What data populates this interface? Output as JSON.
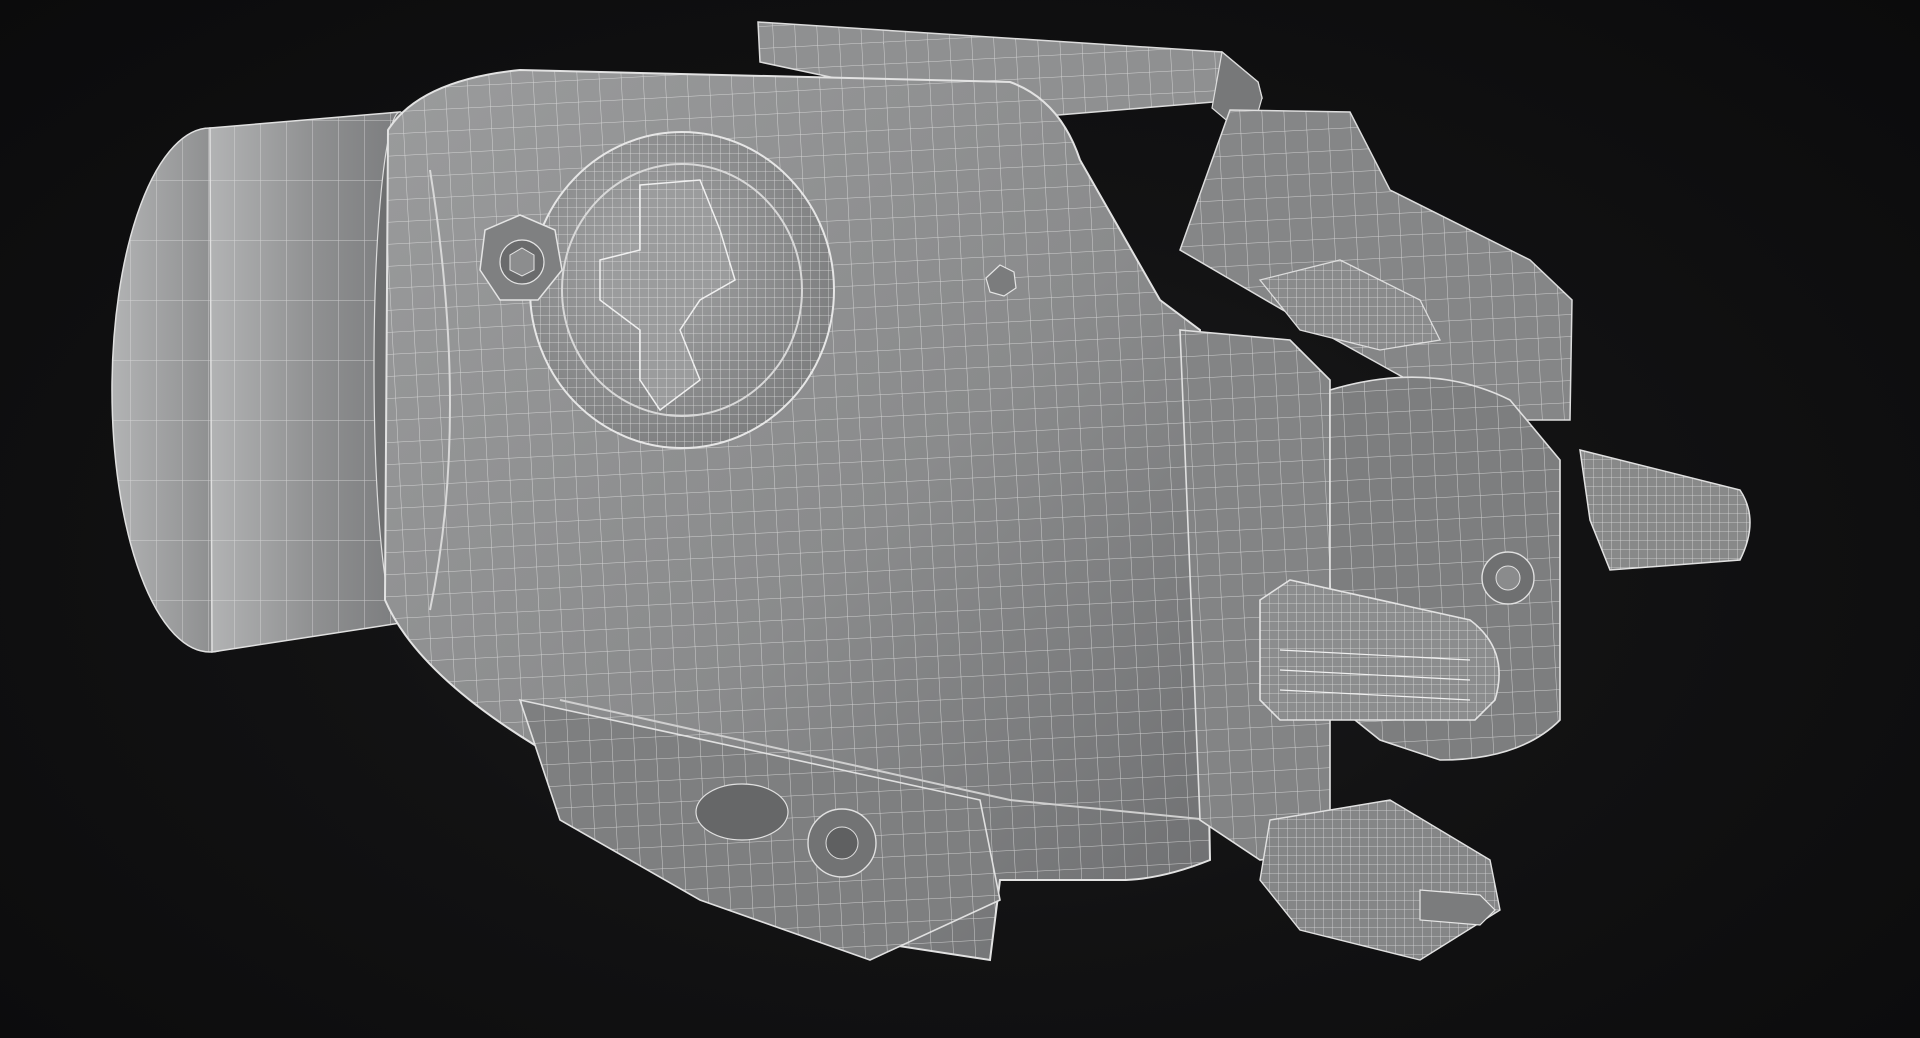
{
  "scene": {
    "subject": "wireframe-render-weapon-light",
    "background_color": "#0f0f10",
    "surface_color": "#8e8f90",
    "wire_color": "#e8e8e8"
  }
}
